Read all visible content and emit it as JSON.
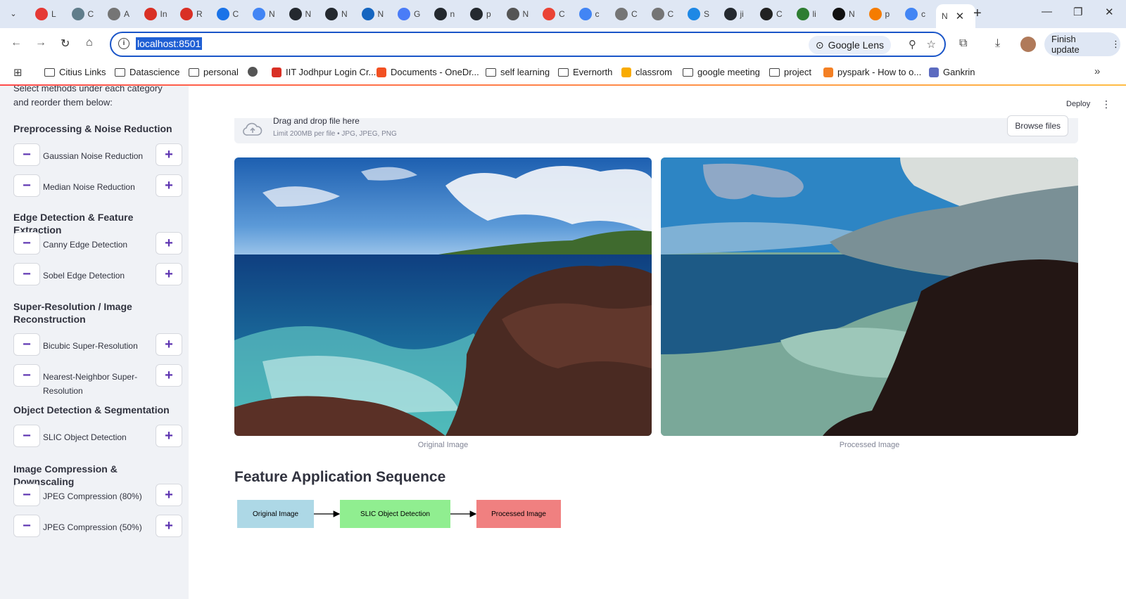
{
  "browser": {
    "tabs": [
      {
        "letter": "L",
        "color": "#e53935"
      },
      {
        "letter": "C",
        "color": "#607d8b"
      },
      {
        "letter": "A",
        "color": "#757575"
      },
      {
        "letter": "In",
        "color": "#d93025"
      },
      {
        "letter": "R",
        "color": "#d93025"
      },
      {
        "letter": "C",
        "color": "#1a73e8"
      },
      {
        "letter": "N",
        "color": "#4285f4"
      },
      {
        "letter": "N",
        "color": "#24292f"
      },
      {
        "letter": "N",
        "color": "#24292f"
      },
      {
        "letter": "N",
        "color": "#1565c0"
      },
      {
        "letter": "G",
        "color": "#4a7cf7"
      },
      {
        "letter": "n",
        "color": "#24292f"
      },
      {
        "letter": "p",
        "color": "#24292f"
      },
      {
        "letter": "N",
        "color": "#555555"
      },
      {
        "letter": "C",
        "color": "#ea4335"
      },
      {
        "letter": "c",
        "color": "#4285f4"
      },
      {
        "letter": "C",
        "color": "#757575"
      },
      {
        "letter": "C",
        "color": "#757575"
      },
      {
        "letter": "S",
        "color": "#1e88e5"
      },
      {
        "letter": "ji",
        "color": "#24292f"
      },
      {
        "letter": "C",
        "color": "#222222"
      },
      {
        "letter": "li",
        "color": "#2e7d32"
      },
      {
        "letter": "N",
        "color": "#111111"
      },
      {
        "letter": "p",
        "color": "#f57c00"
      },
      {
        "letter": "c",
        "color": "#4285f4"
      }
    ],
    "active_tab": {
      "letter": "N"
    },
    "url": "localhost:8501",
    "lens_label": "Google Lens",
    "finish_update": "Finish update",
    "bookmarks": [
      {
        "label": "Citius Links",
        "type": "folder"
      },
      {
        "label": "Datascience",
        "type": "folder"
      },
      {
        "label": "personal",
        "type": "folder"
      },
      {
        "label": "",
        "type": "globe"
      },
      {
        "label": "IIT Jodhpur Login Cr...",
        "type": "gmail"
      },
      {
        "label": "Documents - OneDr...",
        "type": "ms"
      },
      {
        "label": "self learning",
        "type": "folder"
      },
      {
        "label": "Evernorth",
        "type": "folder"
      },
      {
        "label": "classrom",
        "type": "classroom"
      },
      {
        "label": "google meeting",
        "type": "folder"
      },
      {
        "label": "project",
        "type": "folder"
      },
      {
        "label": "pyspark - How to o...",
        "type": "so"
      },
      {
        "label": "Gankrin",
        "type": "gk"
      }
    ]
  },
  "sidebar": {
    "intro": "Select methods under each category and reorder them below:",
    "groups": [
      {
        "title": "Preprocessing & Noise Reduction",
        "items": [
          "Gaussian Noise Reduction",
          "Median Noise Reduction"
        ]
      },
      {
        "title": "Edge Detection & Feature Extraction",
        "items": [
          "Canny Edge Detection",
          "Sobel Edge Detection"
        ]
      },
      {
        "title": "Super-Resolution / Image Reconstruction",
        "items": [
          "Bicubic Super-Resolution",
          "Nearest-Neighbor Super-Resolution"
        ]
      },
      {
        "title": "Object Detection & Segmentation",
        "items": [
          "SLIC Object Detection"
        ]
      },
      {
        "title": "Image Compression & Downscaling",
        "items": [
          "JPEG Compression (80%)",
          "JPEG Compression (50%)"
        ]
      }
    ],
    "minus_glyph": "−",
    "plus_glyph": "+"
  },
  "main": {
    "deploy": "Deploy",
    "uploader": {
      "main_text": "Drag and drop file here",
      "sub_text": "Limit 200MB per file • JPG, JPEG, PNG",
      "browse": "Browse files"
    },
    "original_caption": "Original Image",
    "processed_caption": "Processed Image",
    "sequence_title": "Feature Application Sequence",
    "sequence": [
      {
        "label": "Original Image",
        "color": "#add8e6"
      },
      {
        "label": "SLIC Object Detection",
        "color": "#90ee90"
      },
      {
        "label": "Processed Image",
        "color": "#f08080"
      }
    ]
  }
}
